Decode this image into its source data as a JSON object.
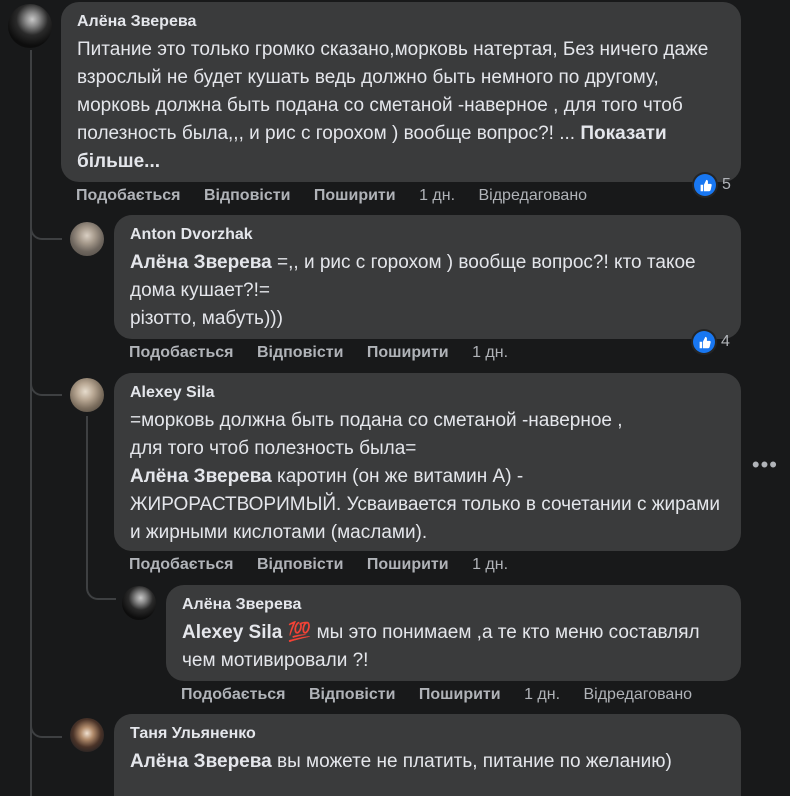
{
  "comments": [
    {
      "author": "Алёна Зверева",
      "text": "Питание это только громко сказано,морковь натертая, Без ничего даже взрослый не будет кушать ведь должно быть немного по другому, морковь должна быть подана со сметаной -наверное , для того чтоб полезность была,,, и рис с горохом ) вообще вопрос?! ... ",
      "see_more": "Показати більше...",
      "actions": {
        "like": "Подобається",
        "reply": "Відповісти",
        "share": "Поширити",
        "time": "1 дн.",
        "edited": "Відредаговано"
      },
      "reactions": "5"
    },
    {
      "author": "Anton Dvorzhak",
      "mention": "Алёна Зверева",
      "text": " =,, и рис с горохом ) вообще вопрос?! кто такое дома кушает?!=\nрізотто, мабуть)))",
      "actions": {
        "like": "Подобається",
        "reply": "Відповісти",
        "share": "Поширити",
        "time": "1 дн."
      },
      "reactions": "4"
    },
    {
      "author": "Alexey Sila",
      "pre_text": "=морковь должна быть подана со сметаной -наверное ,\nдля того чтоб полезность была=\n",
      "mention": "Алёна Зверева",
      "text": " каротин (он же витамин А) - ЖИРОРАСТВОРИМЫЙ. Усваивается только в сочетании с жирами и жирными кислотами (маслами).",
      "actions": {
        "like": "Подобається",
        "reply": "Відповісти",
        "share": "Поширити",
        "time": "1 дн."
      }
    },
    {
      "author": "Алёна Зверева",
      "mention": "Alexey Sila",
      "emoji": "💯",
      "text": " мы это понимаем ,а те кто меню составлял чем мотивировали ?!",
      "actions": {
        "like": "Подобається",
        "reply": "Відповісти",
        "share": "Поширити",
        "time": "1 дн.",
        "edited": "Відредаговано"
      }
    },
    {
      "author": "Таня Ульяненко",
      "mention": "Алёна Зверева",
      "text": " вы можете не платить, питание по желанию)"
    }
  ],
  "more_options": "•••",
  "icons": {
    "like": "thumbs-up-icon",
    "more": "more-options-icon"
  },
  "colors": {
    "background": "#18191a",
    "bubble": "#3a3b3c",
    "like_blue": "#1877f2",
    "secondary_text": "#b0b3b8"
  }
}
